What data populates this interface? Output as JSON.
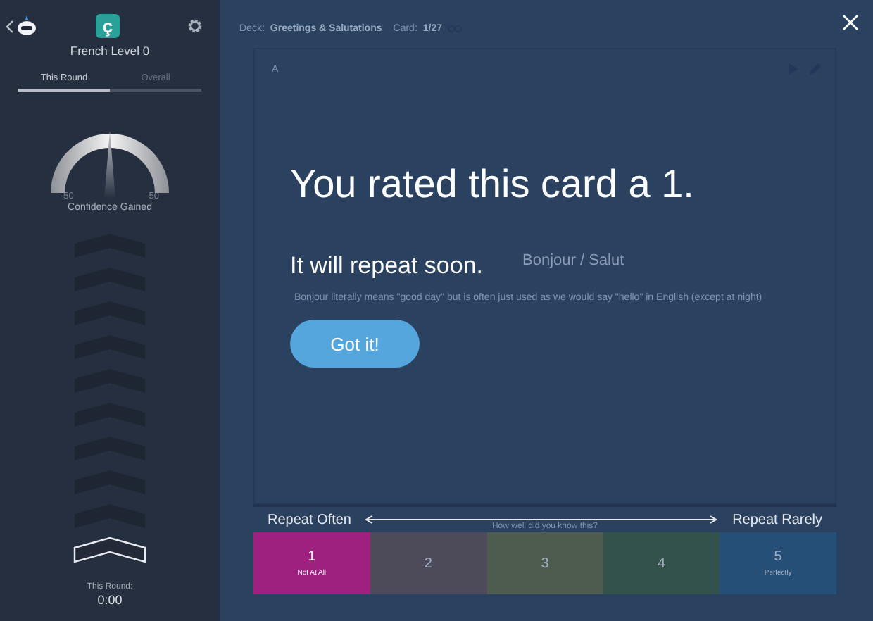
{
  "sidebar": {
    "title": "French Level 0",
    "logo_letter": "ç",
    "tabs": [
      {
        "label": "This Round",
        "selected": true
      },
      {
        "label": "Overall",
        "selected": false
      }
    ],
    "gauge": {
      "min_label": "-50",
      "max_label": "50",
      "caption": "Confidence Gained"
    },
    "chevrons": [
      {
        "current": false
      },
      {
        "current": false
      },
      {
        "current": false
      },
      {
        "current": false
      },
      {
        "current": false
      },
      {
        "current": false
      },
      {
        "current": false
      },
      {
        "current": false
      },
      {
        "current": false
      },
      {
        "current": true
      }
    ],
    "timer": {
      "label": "This Round:",
      "value": "0:00"
    }
  },
  "breadcrumb": {
    "deck_label": "Deck:",
    "deck": "Greetings & Salutations",
    "card_label": "Card:",
    "card": "1/27"
  },
  "card": {
    "side": "A",
    "front": "Bonjour / Salut",
    "note": "Bonjour literally means \"good day\" but is often just used as we would say \"hello\" in English (except at night)"
  },
  "overlay": {
    "title": "You rated this card a 1.",
    "message": "It will repeat soon.",
    "button": "Got it!"
  },
  "rating": {
    "left": "Repeat Often",
    "right": "Repeat Rarely",
    "prompt": "How well did you know this?",
    "buttons": [
      {
        "number": "1",
        "label": "Not At All",
        "color": "#9e2180",
        "selected": true
      },
      {
        "number": "2",
        "color": "#4d4a5a",
        "selected": false
      },
      {
        "number": "3",
        "color": "#4e5c4f",
        "selected": false
      },
      {
        "number": "4",
        "color": "#33524c",
        "selected": false
      },
      {
        "number": "5",
        "label": "Perfectly",
        "color": "#254f76",
        "selected": false
      }
    ]
  }
}
